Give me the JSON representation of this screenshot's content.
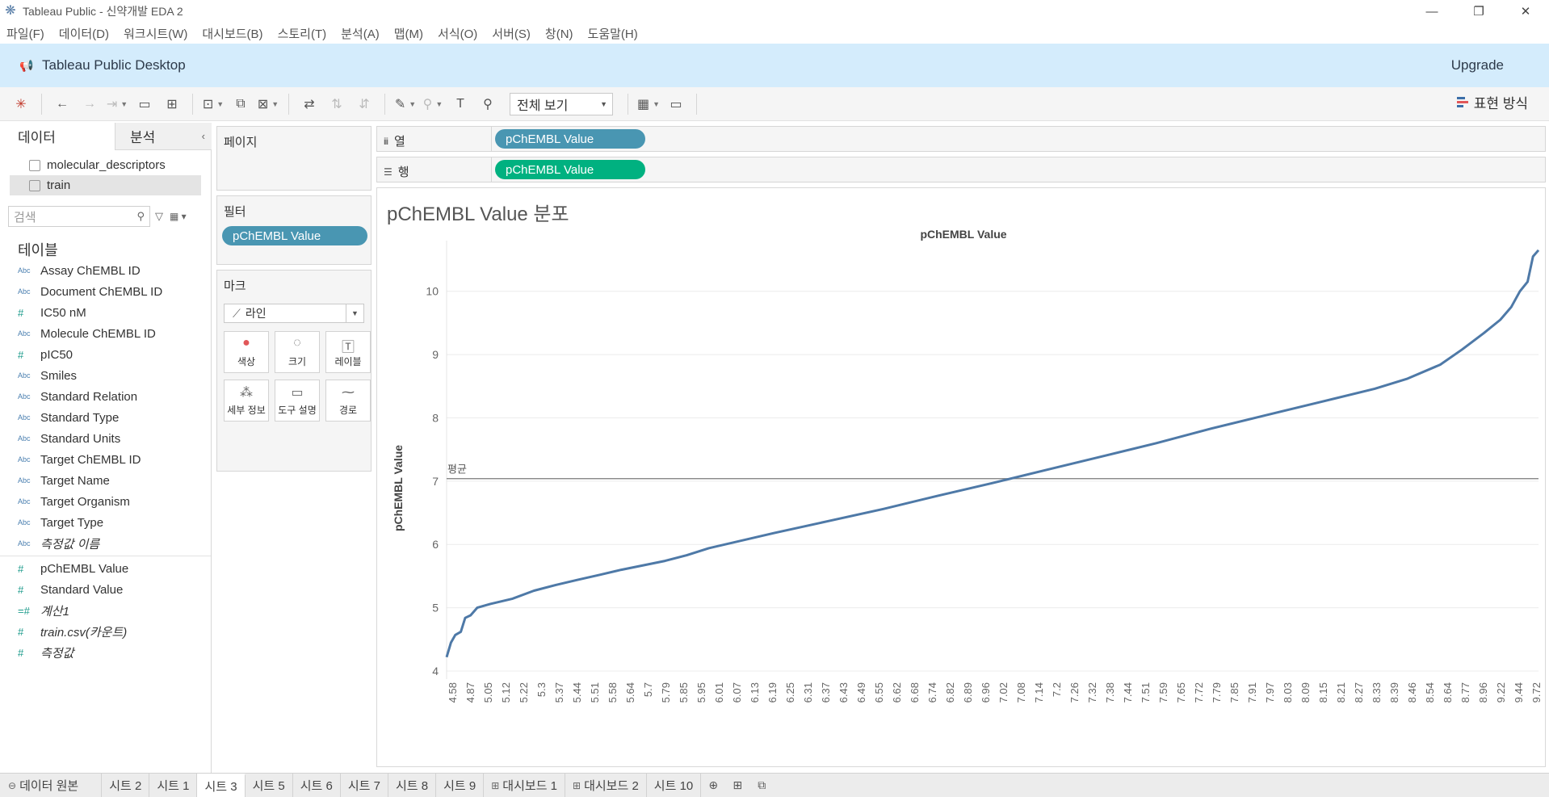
{
  "window": {
    "title": "Tableau Public - 신약개발 EDA 2",
    "minimize": "—",
    "restore": "❐",
    "close": "✕"
  },
  "menu": [
    "파일(F)",
    "데이터(D)",
    "워크시트(W)",
    "대시보드(B)",
    "스토리(T)",
    "분석(A)",
    "맵(M)",
    "서식(O)",
    "서버(S)",
    "창(N)",
    "도움말(H)"
  ],
  "banner": {
    "product": "Tableau Public Desktop",
    "upgrade": "Upgrade"
  },
  "toolbar": {
    "view_mode": "전체 보기",
    "show_me": "표현 방식"
  },
  "data_pane": {
    "tab_data": "데이터",
    "tab_analysis": "분석",
    "collapse": "‹",
    "datasources": [
      "molecular_descriptors",
      "train"
    ],
    "search_placeholder": "검색",
    "tables_header": "테이블",
    "dimensions": [
      {
        "type": "Abc",
        "name": "Assay ChEMBL ID"
      },
      {
        "type": "Abc",
        "name": "Document ChEMBL ID"
      },
      {
        "type": "#",
        "name": "IC50 nM"
      },
      {
        "type": "Abc",
        "name": "Molecule ChEMBL ID"
      },
      {
        "type": "#",
        "name": "pIC50"
      },
      {
        "type": "Abc",
        "name": "Smiles"
      },
      {
        "type": "Abc",
        "name": "Standard Relation"
      },
      {
        "type": "Abc",
        "name": "Standard Type"
      },
      {
        "type": "Abc",
        "name": "Standard Units"
      },
      {
        "type": "Abc",
        "name": "Target ChEMBL ID"
      },
      {
        "type": "Abc",
        "name": "Target Name"
      },
      {
        "type": "Abc",
        "name": "Target Organism"
      },
      {
        "type": "Abc",
        "name": "Target Type"
      },
      {
        "type": "Abc",
        "name": "측정값 이름"
      }
    ],
    "measures": [
      {
        "type": "#",
        "name": "pChEMBL Value"
      },
      {
        "type": "#",
        "name": "Standard Value"
      },
      {
        "type": "=#",
        "name": "계산1"
      },
      {
        "type": "#",
        "name": "train.csv(카운트)"
      },
      {
        "type": "#",
        "name": "측정값"
      }
    ]
  },
  "cards": {
    "pages": "페이지",
    "filters": "필터",
    "filter_pill": "pChEMBL Value",
    "marks": "마크",
    "mark_type": "라인",
    "mark_buttons": [
      "색상",
      "크기",
      "레이블",
      "세부 정보",
      "도구 설명",
      "경로"
    ]
  },
  "shelves": {
    "columns_label": "열",
    "rows_label": "행",
    "columns_pill": "pChEMBL Value",
    "rows_pill": "pChEMBL Value"
  },
  "sheet": {
    "title": "pChEMBL Value 분포",
    "header": "pChEMBL Value",
    "reference_label": "평균"
  },
  "colors": {
    "line": "#4e79a7",
    "reference": "#7a7a7a",
    "pill_blue": "#4996b2",
    "pill_green": "#00b180",
    "banner": "#d4ecfc"
  },
  "chart_data": {
    "type": "line",
    "title": "pChEMBL Value 분포",
    "header": "pChEMBL Value",
    "ylabel": "pChEMBL Value",
    "xlabel": "",
    "ylim": [
      4,
      10.8
    ],
    "yticks": [
      4,
      5,
      6,
      7,
      8,
      9,
      10
    ],
    "reference_line": {
      "label": "평균",
      "value": 7.04
    },
    "x_tick_labels": [
      "4.58",
      "4.87",
      "5.05",
      "5.12",
      "5.22",
      "5.3",
      "5.37",
      "5.44",
      "5.51",
      "5.58",
      "5.64",
      "5.7",
      "5.79",
      "5.85",
      "5.95",
      "6.01",
      "6.07",
      "6.13",
      "6.19",
      "6.25",
      "6.31",
      "6.37",
      "6.43",
      "6.49",
      "6.55",
      "6.62",
      "6.68",
      "6.74",
      "6.82",
      "6.89",
      "6.96",
      "7.02",
      "7.08",
      "7.14",
      "7.2",
      "7.26",
      "7.32",
      "7.38",
      "7.44",
      "7.51",
      "7.59",
      "7.65",
      "7.72",
      "7.79",
      "7.85",
      "7.91",
      "7.97",
      "8.03",
      "8.09",
      "8.15",
      "8.21",
      "8.27",
      "8.33",
      "8.39",
      "8.46",
      "8.54",
      "8.64",
      "8.77",
      "8.96",
      "9.22",
      "9.44",
      "9.72"
    ],
    "curve": [
      [
        0,
        4.22
      ],
      [
        0.004,
        4.45
      ],
      [
        0.008,
        4.57
      ],
      [
        0.013,
        4.62
      ],
      [
        0.017,
        4.84
      ],
      [
        0.022,
        4.88
      ],
      [
        0.028,
        5.0
      ],
      [
        0.04,
        5.06
      ],
      [
        0.06,
        5.14
      ],
      [
        0.08,
        5.27
      ],
      [
        0.1,
        5.36
      ],
      [
        0.12,
        5.44
      ],
      [
        0.14,
        5.52
      ],
      [
        0.16,
        5.6
      ],
      [
        0.18,
        5.67
      ],
      [
        0.2,
        5.74
      ],
      [
        0.22,
        5.83
      ],
      [
        0.24,
        5.94
      ],
      [
        0.3,
        6.18
      ],
      [
        0.35,
        6.37
      ],
      [
        0.4,
        6.56
      ],
      [
        0.45,
        6.77
      ],
      [
        0.5,
        6.97
      ],
      [
        0.55,
        7.18
      ],
      [
        0.6,
        7.39
      ],
      [
        0.65,
        7.6
      ],
      [
        0.7,
        7.83
      ],
      [
        0.75,
        8.04
      ],
      [
        0.8,
        8.25
      ],
      [
        0.85,
        8.46
      ],
      [
        0.88,
        8.62
      ],
      [
        0.91,
        8.84
      ],
      [
        0.93,
        9.08
      ],
      [
        0.95,
        9.34
      ],
      [
        0.965,
        9.55
      ],
      [
        0.975,
        9.75
      ],
      [
        0.983,
        10.0
      ],
      [
        0.99,
        10.15
      ],
      [
        0.995,
        10.55
      ],
      [
        1.0,
        10.65
      ]
    ]
  },
  "sheet_tabs": {
    "datasource": "데이터 원본",
    "tabs": [
      {
        "label": "시트 2",
        "kind": "sheet"
      },
      {
        "label": "시트 1",
        "kind": "sheet"
      },
      {
        "label": "시트 3",
        "kind": "sheet",
        "active": true
      },
      {
        "label": "시트 5",
        "kind": "sheet"
      },
      {
        "label": "시트 6",
        "kind": "sheet"
      },
      {
        "label": "시트 7",
        "kind": "sheet"
      },
      {
        "label": "시트 8",
        "kind": "sheet"
      },
      {
        "label": "시트 9",
        "kind": "sheet"
      },
      {
        "label": "대시보드 1",
        "kind": "dashboard"
      },
      {
        "label": "대시보드 2",
        "kind": "dashboard"
      },
      {
        "label": "시트 10",
        "kind": "sheet"
      }
    ]
  }
}
